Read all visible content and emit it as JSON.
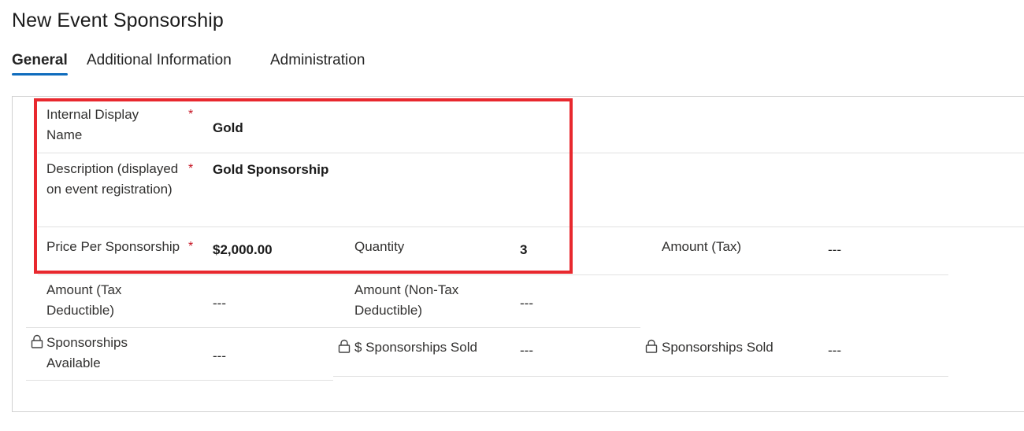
{
  "page": {
    "title": "New Event Sponsorship"
  },
  "tabs": [
    {
      "label": "General"
    },
    {
      "label": "Additional Information"
    },
    {
      "label": "Administration"
    }
  ],
  "fields": {
    "internal_display_name": {
      "label": "Internal Display Name",
      "required_mark": "*",
      "value": "Gold"
    },
    "description": {
      "label": "Description (displayed on event registration)",
      "required_mark": "*",
      "value": "Gold Sponsorship"
    },
    "price_per_sponsorship": {
      "label": "Price Per Sponsorship",
      "required_mark": "*",
      "value": "$2,000.00"
    },
    "quantity": {
      "label": "Quantity",
      "value": "3"
    },
    "amount_tax": {
      "label": "Amount (Tax)",
      "value": "---"
    },
    "amount_tax_deductible": {
      "label": "Amount (Tax Deductible)",
      "value": "---"
    },
    "amount_non_tax_deductible": {
      "label": "Amount (Non-Tax Deductible)",
      "value": "---"
    },
    "sponsorships_available": {
      "label": "Sponsorships Available",
      "value": "---",
      "icon": "lock-icon"
    },
    "dollar_sponsorships_sold": {
      "label": "$ Sponsorships Sold",
      "value": "---",
      "icon": "lock-icon"
    },
    "sponsorships_sold": {
      "label": "Sponsorships Sold",
      "value": "---",
      "icon": "lock-icon"
    }
  },
  "colors": {
    "accent": "#0f6cbd",
    "required": "#c50f1f",
    "highlight": "#e8282e"
  }
}
